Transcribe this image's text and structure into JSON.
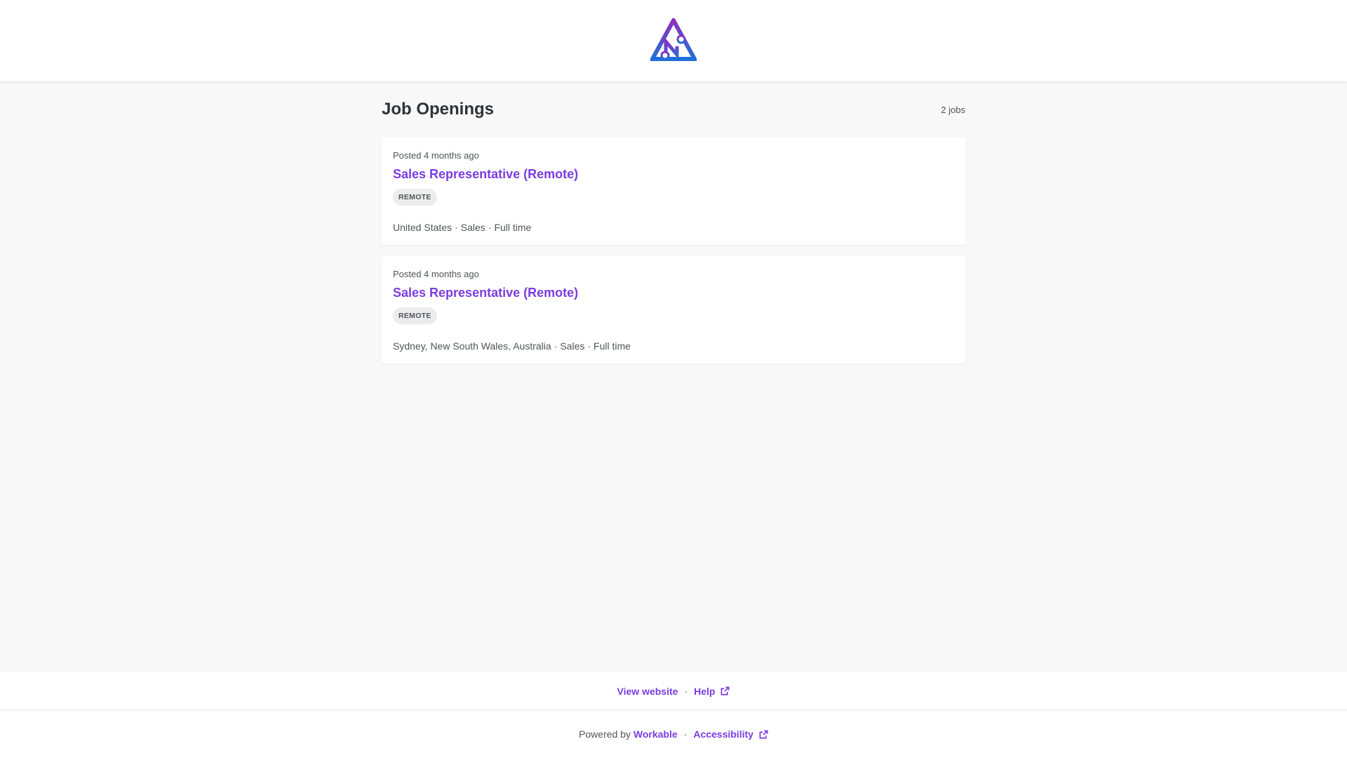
{
  "header": {
    "logo_icon": "company-logo-icon",
    "colors": {
      "logo_top": "#8e2fbf",
      "logo_bottom": "#1e6fd9"
    }
  },
  "listing": {
    "title": "Job Openings",
    "job_count": "2 jobs",
    "jobs": [
      {
        "posted": "Posted 4 months ago",
        "title": "Sales Representative (Remote)",
        "badge": "REMOTE",
        "location": "United States",
        "department": "Sales",
        "type": "Full time"
      },
      {
        "posted": "Posted 4 months ago",
        "title": "Sales Representative (Remote)",
        "badge": "REMOTE",
        "location": "Sydney, New South Wales, Australia",
        "department": "Sales",
        "type": "Full time"
      }
    ],
    "separator": "·"
  },
  "footer": {
    "view_website": "View website",
    "help": "Help",
    "powered_by": "Powered by",
    "workable": "Workable",
    "accessibility": "Accessibility",
    "dot": "·",
    "external_icon": "external-link-icon"
  },
  "colors": {
    "accent": "#7b3ce0",
    "text": "#2d3339",
    "muted": "#505459",
    "background": "#f8f8f8"
  }
}
